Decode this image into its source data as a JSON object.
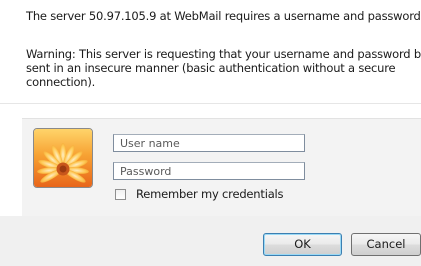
{
  "dialog": {
    "server_message": "The server 50.97.105.9 at WebMail requires a username and password.",
    "warning_lines": [
      "Warning: This server is requesting that your username and password be",
      "sent in an insecure manner (basic authentication without a secure",
      "connection)."
    ]
  },
  "credentials": {
    "user_tile_icon": "flower-user-picture-icon",
    "username": {
      "placeholder": "User name",
      "value": ""
    },
    "password": {
      "placeholder": "Password",
      "value": ""
    },
    "remember": {
      "label": "Remember my credentials",
      "checked": false
    }
  },
  "buttons": {
    "ok_label": "OK",
    "cancel_label": "Cancel"
  },
  "colors": {
    "button_focus_border": "#3c7fb1",
    "band_background": "#f3f3f3",
    "button_bar_background": "#f0f0f0"
  }
}
